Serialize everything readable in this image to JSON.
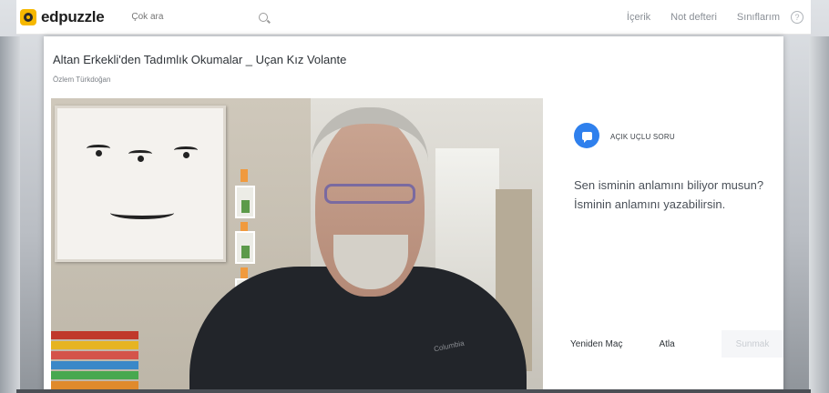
{
  "navbar": {
    "logo_text": "edpuzzle",
    "search_placeholder": "Çok ara",
    "links": [
      "İçerik",
      "Not defteri",
      "Sınıflarım"
    ],
    "help": "?"
  },
  "lesson": {
    "title": "Altan Erkekli'den Tadımlık Okumalar _ Uçan Kız Volante",
    "author": "Özlem Türkdoğan"
  },
  "question": {
    "type_label": "AÇIK UÇLU SORU",
    "line1": "Sen isminin anlamını biliyor musun?",
    "line2": "İsminin anlamını yazabilirsin.",
    "rewatch_label": "Yeniden Maç",
    "skip_label": "Atla",
    "submit_label": "Sunmak"
  },
  "video": {
    "shirt_logo": "Columbia"
  },
  "colors": {
    "accent": "#2f80ed",
    "logo": "#f6b800"
  }
}
